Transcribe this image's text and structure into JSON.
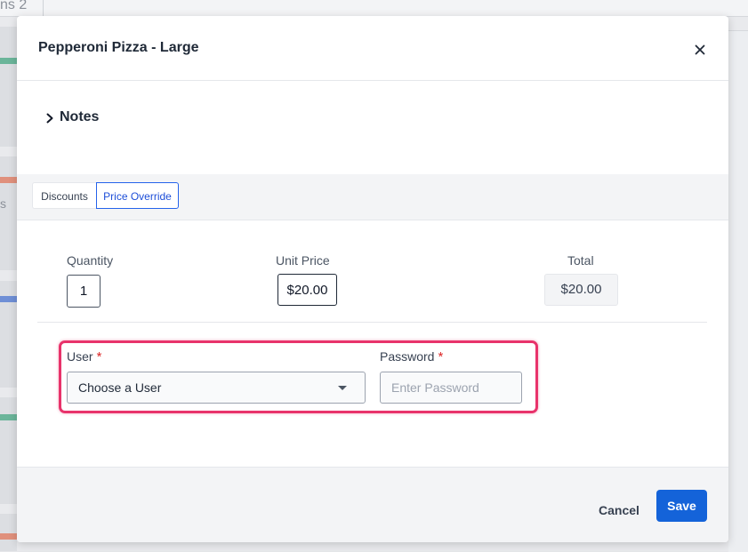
{
  "background": {
    "tab_label": "ns 2",
    "side_letter": "s",
    "stripe_colors": [
      "#6bb59a",
      "#e0907c",
      "#6f8fd6",
      "#6bb59a",
      "#e0907c"
    ]
  },
  "modal": {
    "title": "Pepperoni Pizza - Large",
    "close_icon": "close-icon",
    "notes_label": "Notes",
    "tabs": [
      {
        "label": "Discounts",
        "active": false
      },
      {
        "label": "Price Override",
        "active": true
      }
    ],
    "pricing": {
      "quantity_label": "Quantity",
      "quantity_value": "1",
      "unit_price_label": "Unit Price",
      "unit_price_value": "$20.00",
      "total_label": "Total",
      "total_value": "$20.00"
    },
    "auth": {
      "user_label": "User",
      "user_placeholder": "Choose a User",
      "password_label": "Password",
      "password_placeholder": "Enter Password",
      "required_mark": "*",
      "highlight_color": "#e8336b"
    },
    "footer": {
      "cancel_label": "Cancel",
      "save_label": "Save"
    },
    "colors": {
      "primary": "#1463d9",
      "required": "#dc2626"
    }
  }
}
